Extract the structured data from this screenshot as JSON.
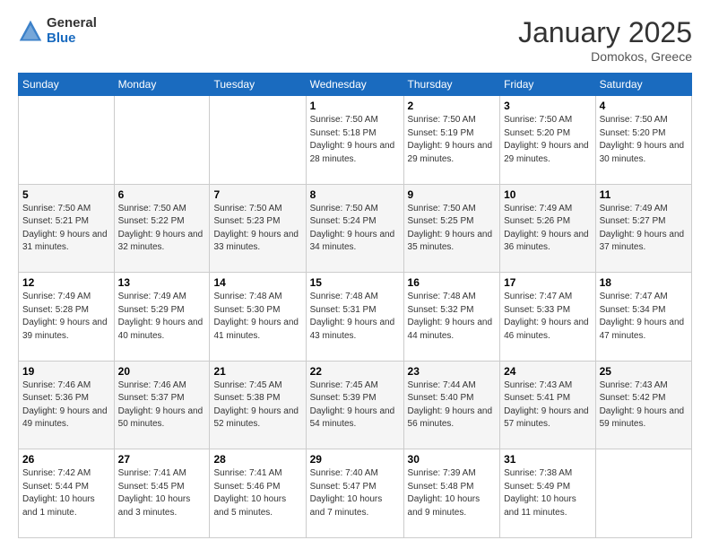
{
  "logo": {
    "general": "General",
    "blue": "Blue"
  },
  "header": {
    "month": "January 2025",
    "location": "Domokos, Greece"
  },
  "days_header": [
    "Sunday",
    "Monday",
    "Tuesday",
    "Wednesday",
    "Thursday",
    "Friday",
    "Saturday"
  ],
  "weeks": [
    [
      {
        "day": "",
        "info": ""
      },
      {
        "day": "",
        "info": ""
      },
      {
        "day": "",
        "info": ""
      },
      {
        "day": "1",
        "info": "Sunrise: 7:50 AM\nSunset: 5:18 PM\nDaylight: 9 hours\nand 28 minutes."
      },
      {
        "day": "2",
        "info": "Sunrise: 7:50 AM\nSunset: 5:19 PM\nDaylight: 9 hours\nand 29 minutes."
      },
      {
        "day": "3",
        "info": "Sunrise: 7:50 AM\nSunset: 5:20 PM\nDaylight: 9 hours\nand 29 minutes."
      },
      {
        "day": "4",
        "info": "Sunrise: 7:50 AM\nSunset: 5:20 PM\nDaylight: 9 hours\nand 30 minutes."
      }
    ],
    [
      {
        "day": "5",
        "info": "Sunrise: 7:50 AM\nSunset: 5:21 PM\nDaylight: 9 hours\nand 31 minutes."
      },
      {
        "day": "6",
        "info": "Sunrise: 7:50 AM\nSunset: 5:22 PM\nDaylight: 9 hours\nand 32 minutes."
      },
      {
        "day": "7",
        "info": "Sunrise: 7:50 AM\nSunset: 5:23 PM\nDaylight: 9 hours\nand 33 minutes."
      },
      {
        "day": "8",
        "info": "Sunrise: 7:50 AM\nSunset: 5:24 PM\nDaylight: 9 hours\nand 34 minutes."
      },
      {
        "day": "9",
        "info": "Sunrise: 7:50 AM\nSunset: 5:25 PM\nDaylight: 9 hours\nand 35 minutes."
      },
      {
        "day": "10",
        "info": "Sunrise: 7:49 AM\nSunset: 5:26 PM\nDaylight: 9 hours\nand 36 minutes."
      },
      {
        "day": "11",
        "info": "Sunrise: 7:49 AM\nSunset: 5:27 PM\nDaylight: 9 hours\nand 37 minutes."
      }
    ],
    [
      {
        "day": "12",
        "info": "Sunrise: 7:49 AM\nSunset: 5:28 PM\nDaylight: 9 hours\nand 39 minutes."
      },
      {
        "day": "13",
        "info": "Sunrise: 7:49 AM\nSunset: 5:29 PM\nDaylight: 9 hours\nand 40 minutes."
      },
      {
        "day": "14",
        "info": "Sunrise: 7:48 AM\nSunset: 5:30 PM\nDaylight: 9 hours\nand 41 minutes."
      },
      {
        "day": "15",
        "info": "Sunrise: 7:48 AM\nSunset: 5:31 PM\nDaylight: 9 hours\nand 43 minutes."
      },
      {
        "day": "16",
        "info": "Sunrise: 7:48 AM\nSunset: 5:32 PM\nDaylight: 9 hours\nand 44 minutes."
      },
      {
        "day": "17",
        "info": "Sunrise: 7:47 AM\nSunset: 5:33 PM\nDaylight: 9 hours\nand 46 minutes."
      },
      {
        "day": "18",
        "info": "Sunrise: 7:47 AM\nSunset: 5:34 PM\nDaylight: 9 hours\nand 47 minutes."
      }
    ],
    [
      {
        "day": "19",
        "info": "Sunrise: 7:46 AM\nSunset: 5:36 PM\nDaylight: 9 hours\nand 49 minutes."
      },
      {
        "day": "20",
        "info": "Sunrise: 7:46 AM\nSunset: 5:37 PM\nDaylight: 9 hours\nand 50 minutes."
      },
      {
        "day": "21",
        "info": "Sunrise: 7:45 AM\nSunset: 5:38 PM\nDaylight: 9 hours\nand 52 minutes."
      },
      {
        "day": "22",
        "info": "Sunrise: 7:45 AM\nSunset: 5:39 PM\nDaylight: 9 hours\nand 54 minutes."
      },
      {
        "day": "23",
        "info": "Sunrise: 7:44 AM\nSunset: 5:40 PM\nDaylight: 9 hours\nand 56 minutes."
      },
      {
        "day": "24",
        "info": "Sunrise: 7:43 AM\nSunset: 5:41 PM\nDaylight: 9 hours\nand 57 minutes."
      },
      {
        "day": "25",
        "info": "Sunrise: 7:43 AM\nSunset: 5:42 PM\nDaylight: 9 hours\nand 59 minutes."
      }
    ],
    [
      {
        "day": "26",
        "info": "Sunrise: 7:42 AM\nSunset: 5:44 PM\nDaylight: 10 hours\nand 1 minute."
      },
      {
        "day": "27",
        "info": "Sunrise: 7:41 AM\nSunset: 5:45 PM\nDaylight: 10 hours\nand 3 minutes."
      },
      {
        "day": "28",
        "info": "Sunrise: 7:41 AM\nSunset: 5:46 PM\nDaylight: 10 hours\nand 5 minutes."
      },
      {
        "day": "29",
        "info": "Sunrise: 7:40 AM\nSunset: 5:47 PM\nDaylight: 10 hours\nand 7 minutes."
      },
      {
        "day": "30",
        "info": "Sunrise: 7:39 AM\nSunset: 5:48 PM\nDaylight: 10 hours\nand 9 minutes."
      },
      {
        "day": "31",
        "info": "Sunrise: 7:38 AM\nSunset: 5:49 PM\nDaylight: 10 hours\nand 11 minutes."
      },
      {
        "day": "",
        "info": ""
      }
    ]
  ]
}
